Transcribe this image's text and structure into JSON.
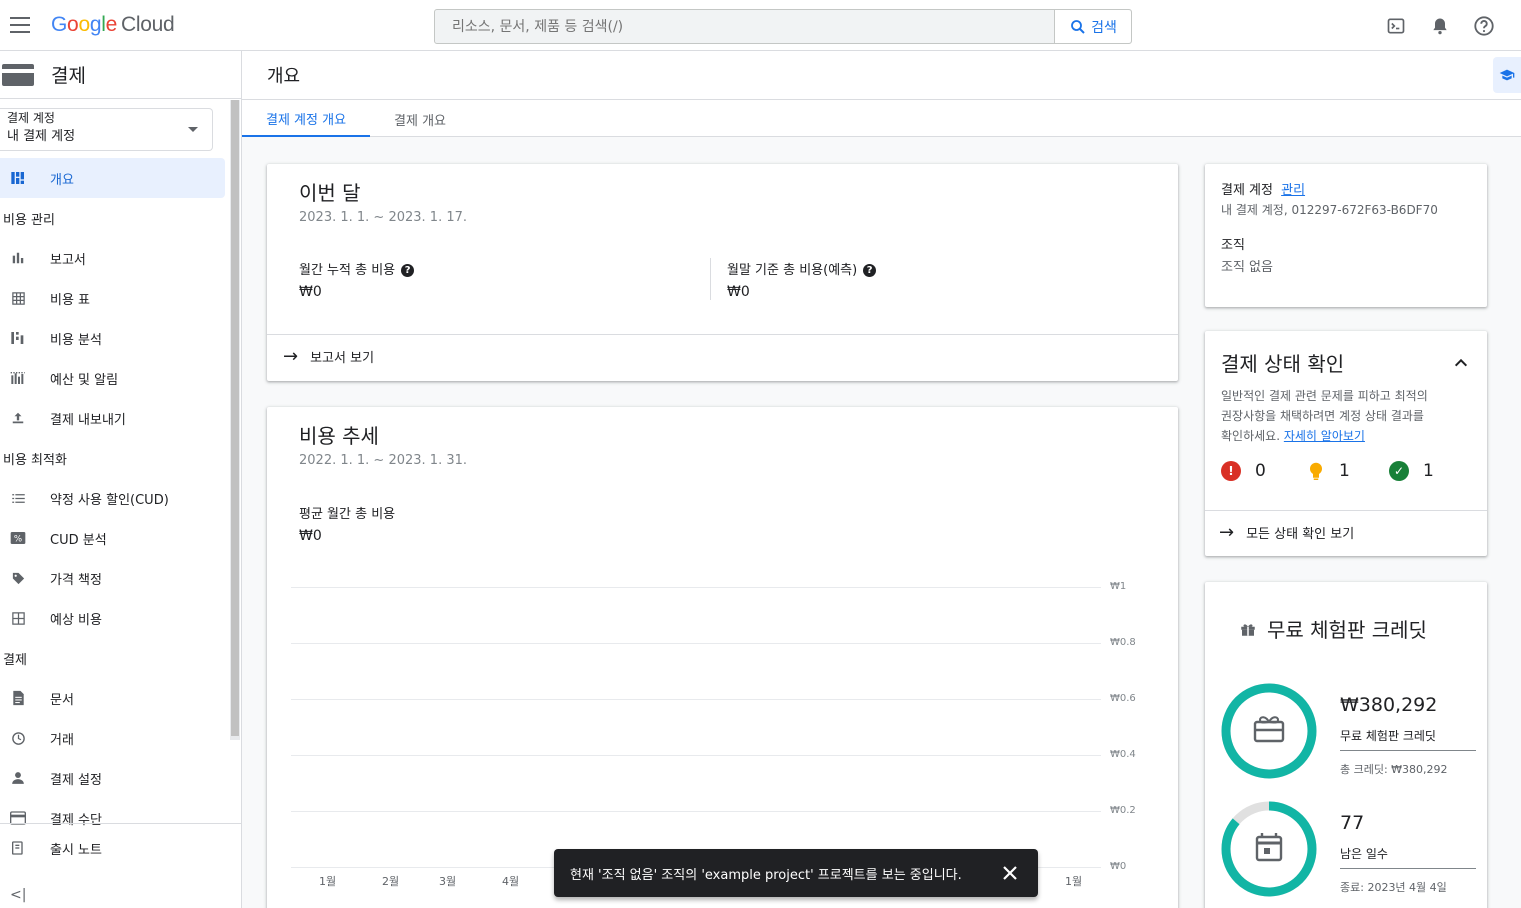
{
  "topbar": {
    "logo_google": "Google",
    "logo_cloud": "Cloud",
    "search_placeholder": "리소스, 문서, 제품 등 검색(/)",
    "search_button": "검색"
  },
  "leftnav": {
    "title": "결제",
    "account_label": "결제 계정",
    "account_value": "내 결제 계정",
    "items": [
      {
        "label": "개요",
        "icon": "dashboard-icon",
        "active": true
      },
      {
        "section": "비용 관리"
      },
      {
        "label": "보고서",
        "icon": "bar-chart-icon"
      },
      {
        "label": "비용 표",
        "icon": "table-icon"
      },
      {
        "label": "비용 분석",
        "icon": "cost-breakdown-icon"
      },
      {
        "label": "예산 및 알림",
        "icon": "budget-icon"
      },
      {
        "label": "결제 내보내기",
        "icon": "upload-icon"
      },
      {
        "section": "비용 최적화"
      },
      {
        "label": "약정 사용 할인(CUD)",
        "icon": "list-icon"
      },
      {
        "label": "CUD 분석",
        "icon": "percent-icon"
      },
      {
        "label": "가격 책정",
        "icon": "tag-icon"
      },
      {
        "label": "예상 비용",
        "icon": "calculator-icon"
      },
      {
        "section": "결제"
      },
      {
        "label": "문서",
        "icon": "document-icon"
      },
      {
        "label": "거래",
        "icon": "clock-icon"
      },
      {
        "label": "결제 설정",
        "icon": "person-icon"
      },
      {
        "label": "결제 수단",
        "icon": "credit-card-icon"
      }
    ],
    "release_notes": "출시 노트",
    "collapse": "<|"
  },
  "main": {
    "page_title": "개요",
    "tabs": [
      "결제 계정 개요",
      "결제 개요"
    ],
    "this_month": {
      "title": "이번 달",
      "range": "2023. 1. 1. ~ 2023. 1. 17.",
      "metric1_label": "월간 누적 총 비용",
      "metric1_value": "₩0",
      "metric2_label": "월말 기준 총 비용(예측)",
      "metric2_value": "₩0",
      "link": "보고서 보기"
    },
    "trend": {
      "title": "비용 추세",
      "range": "2022. 1. 1. ~ 2023. 1. 31.",
      "metric_label": "평균 월간 총 비용",
      "metric_value": "₩0"
    },
    "account_info": {
      "label": "결제 계정",
      "manage_link": "관리",
      "account_line": "내 결제 계정, 012297-672F63-B6DF70",
      "org_label": "조직",
      "org_value": "조직 없음"
    },
    "health": {
      "title": "결제 상태 확인",
      "desc1": "일반적인 결제 관련 문제를 피하고 최적의",
      "desc2": "권장사항을 채택하려면 계정 상태 결과를",
      "desc3": "확인하세요.",
      "learn_more": "자세히 알아보기",
      "error_count": "0",
      "suggestion_count": "1",
      "ok_count": "1",
      "link": "모든 상태 확인 보기",
      "colors": {
        "error": "#d93025",
        "warning": "#f9ab00",
        "ok": "#188038"
      }
    },
    "credits": {
      "title": "무료 체험판 크레딧",
      "amount": "₩380,292",
      "amount_label": "무료 체험판 크레딧",
      "total": "총 크레딧: ₩380,292",
      "days": "77",
      "days_label": "남은 일수",
      "end": "종료: 2023년 4월 4일",
      "credit_fraction": 1.0,
      "days_fraction": 0.86,
      "ring_color": "#12b5a5"
    }
  },
  "chart_data": {
    "type": "bar",
    "categories": [
      "1월",
      "2월",
      "3월",
      "4월",
      "1월"
    ],
    "values": [
      0,
      0,
      0,
      0,
      0
    ],
    "yticks": [
      "₩1",
      "₩0.8",
      "₩0.6",
      "₩0.4",
      "₩0.2",
      "₩0"
    ],
    "ylim": [
      0,
      1
    ],
    "grid": true
  },
  "snackbar": {
    "message": "현재 '조직 없음' 조직의 'example project' 프로젝트를 보는 중입니다."
  }
}
